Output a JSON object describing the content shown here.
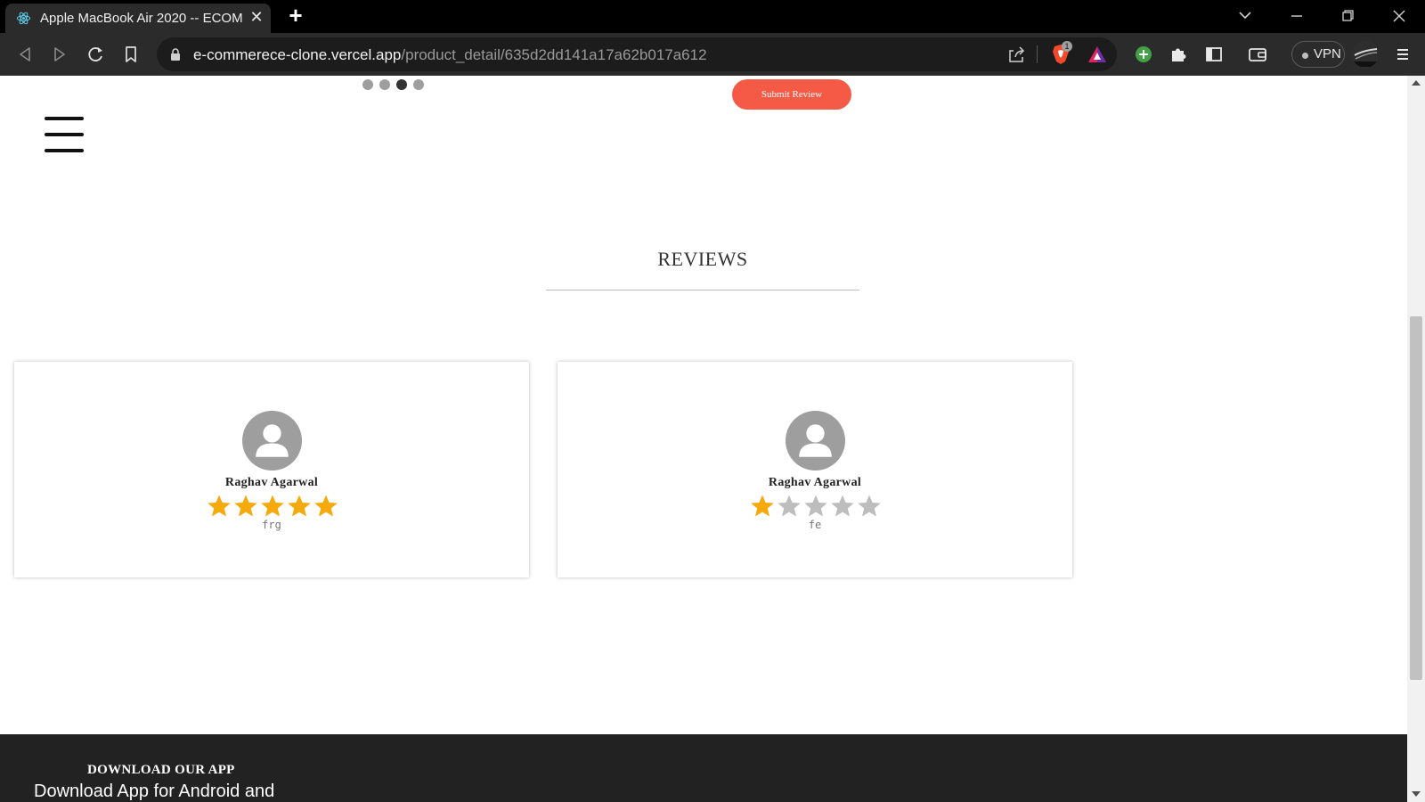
{
  "browser": {
    "tab_title": "Apple MacBook Air 2020 -- ECOM",
    "url_host": "e-commerece-clone.vercel.app",
    "url_path": "/product_detail/635d2dd141a17a62b017a612",
    "shield_count": "1",
    "vpn_label": "VPN"
  },
  "page": {
    "carousel": {
      "count": 4,
      "active_index": 2
    },
    "submit_review_label": "Submit Review",
    "reviews_heading": "REVIEWS",
    "reviews": [
      {
        "name": "Raghav Agarwal",
        "rating": 5,
        "comment": "frg"
      },
      {
        "name": "Raghav Agarwal",
        "rating": 1,
        "comment": "fe"
      }
    ],
    "footer": {
      "title": "DOWNLOAD OUR APP",
      "subtitle": "Download App for Android and"
    }
  },
  "colors": {
    "accent": "#f45a45",
    "star_filled": "#f5a90a",
    "star_empty": "#bdbdbd",
    "footer_bg": "#222222"
  }
}
